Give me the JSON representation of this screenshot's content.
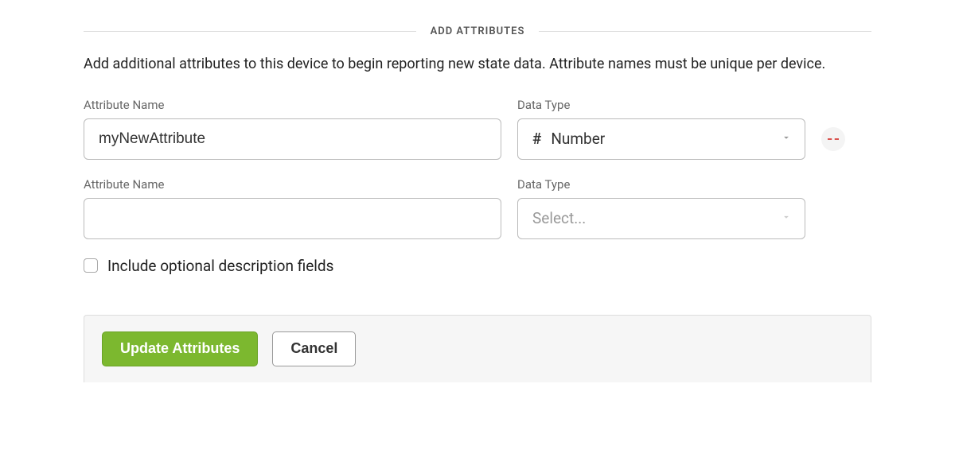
{
  "section": {
    "title": "ADD ATTRIBUTES",
    "description": "Add additional attributes to this device to begin reporting new state data. Attribute names must be unique per device."
  },
  "labels": {
    "attribute_name": "Attribute Name",
    "data_type": "Data Type"
  },
  "rows": [
    {
      "name_value": "myNewAttribute",
      "type_symbol": "#",
      "type_label": "Number",
      "has_remove": true
    },
    {
      "name_value": "",
      "type_placeholder": "Select...",
      "has_remove": false
    }
  ],
  "checkbox": {
    "label": "Include optional description fields",
    "checked": false
  },
  "actions": {
    "update": "Update Attributes",
    "cancel": "Cancel"
  }
}
